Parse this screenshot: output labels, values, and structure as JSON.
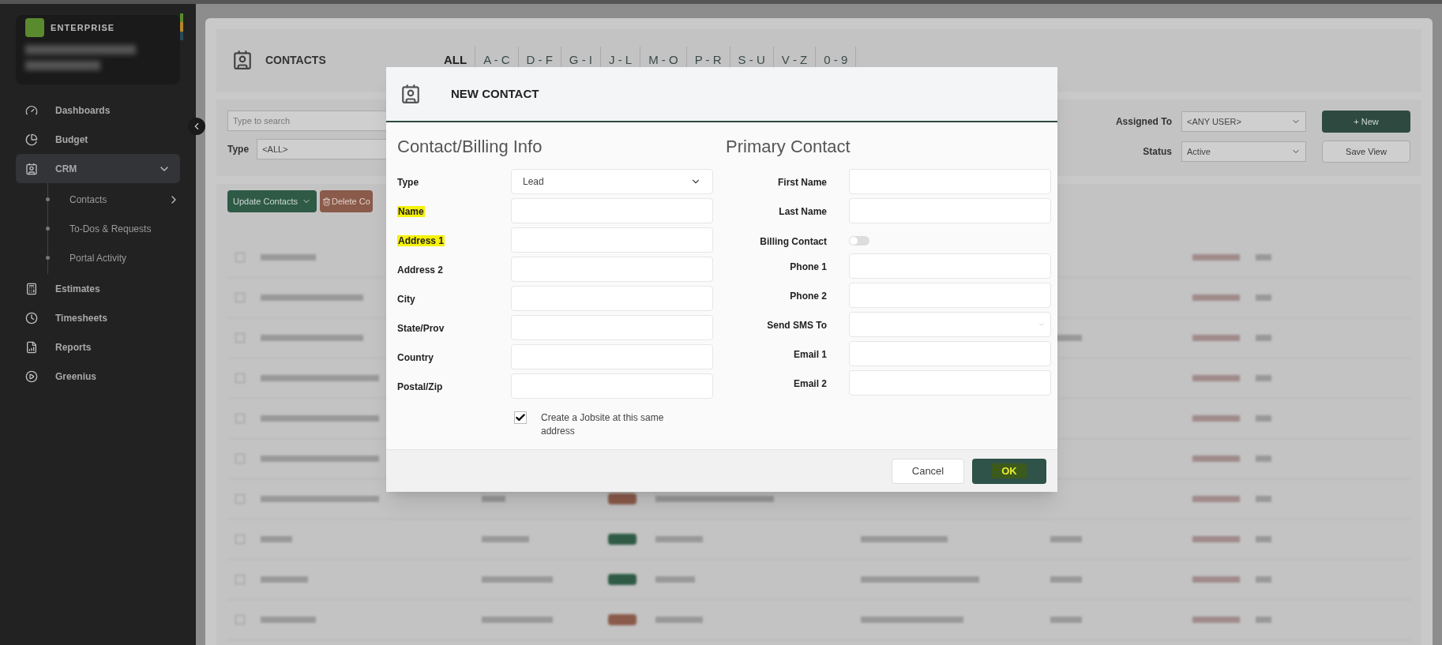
{
  "sidebar": {
    "brand": "ENTERPRISE",
    "items": [
      {
        "label": "Dashboards",
        "selected": false
      },
      {
        "label": "Budget",
        "selected": false
      },
      {
        "label": "CRM",
        "selected": true,
        "expanded": true,
        "children": [
          {
            "label": "Contacts",
            "has_arrow": true
          },
          {
            "label": "To-Dos & Requests",
            "has_arrow": false
          },
          {
            "label": "Portal Activity",
            "has_arrow": false
          }
        ]
      },
      {
        "label": "Estimates",
        "selected": false
      },
      {
        "label": "Timesheets",
        "selected": false
      },
      {
        "label": "Reports",
        "selected": false
      },
      {
        "label": "Greenius",
        "selected": false
      }
    ]
  },
  "page": {
    "title": "CONTACTS",
    "letter_tabs": [
      {
        "label": "ALL",
        "selected": true
      },
      {
        "label": "A - C",
        "selected": false
      },
      {
        "label": "D - F",
        "selected": false
      },
      {
        "label": "G - I",
        "selected": false
      },
      {
        "label": "J - L",
        "selected": false
      },
      {
        "label": "M - O",
        "selected": false
      },
      {
        "label": "P - R",
        "selected": false
      },
      {
        "label": "S - U",
        "selected": false
      },
      {
        "label": "V - Z",
        "selected": false
      },
      {
        "label": "0 - 9",
        "selected": false
      }
    ],
    "search": {
      "placeholder": "Type to search"
    },
    "type_filter": {
      "label": "Type",
      "value": "<ALL>"
    },
    "assigned_filter": {
      "label": "Assigned To",
      "value": "<ANY USER>"
    },
    "status_filter": {
      "label": "Status",
      "value": "Active"
    },
    "new_button": "+ New",
    "save_view_button": "Save View",
    "update_button": "Update Contacts",
    "delete_button": "Delete Co"
  },
  "dialog": {
    "title": "NEW CONTACT",
    "left_heading": "Contact/Billing Info",
    "left_fields": [
      {
        "label": "Type",
        "kind": "select",
        "value": "Lead",
        "highlighted": false
      },
      {
        "label": "Name",
        "kind": "input",
        "highlighted": true
      },
      {
        "label": "Address 1",
        "kind": "input",
        "highlighted": true
      },
      {
        "label": "Address 2",
        "kind": "input",
        "highlighted": false
      },
      {
        "label": "City",
        "kind": "input",
        "highlighted": false
      },
      {
        "label": "State/Prov",
        "kind": "input",
        "highlighted": false
      },
      {
        "label": "Country",
        "kind": "input",
        "highlighted": false
      },
      {
        "label": "Postal/Zip",
        "kind": "input",
        "highlighted": false
      }
    ],
    "jobsite_checkbox": {
      "label": "Create a Jobsite at this same address",
      "checked": true
    },
    "right_heading": "Primary Contact",
    "right_fields": [
      {
        "label": "First Name",
        "kind": "input"
      },
      {
        "label": "Last Name",
        "kind": "input"
      },
      {
        "label": "Billing Contact",
        "kind": "toggle",
        "on": false
      },
      {
        "label": "Phone 1",
        "kind": "input"
      },
      {
        "label": "Phone 2",
        "kind": "input"
      },
      {
        "label": "Send SMS To",
        "kind": "select"
      },
      {
        "label": "Email 1",
        "kind": "input"
      },
      {
        "label": "Email 2",
        "kind": "input"
      }
    ],
    "cancel_button": "Cancel",
    "ok_button": {
      "label": "OK",
      "highlighted": true
    }
  }
}
